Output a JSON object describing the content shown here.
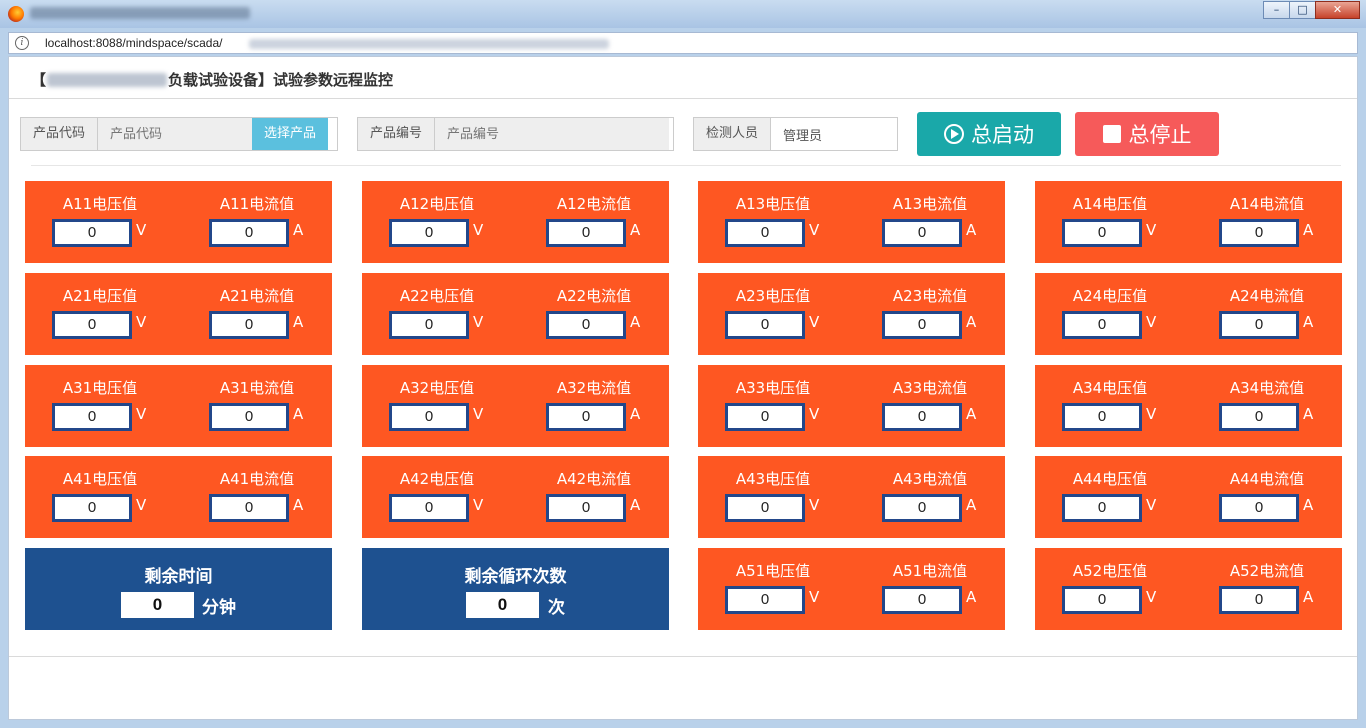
{
  "browser": {
    "url": "localhost:8088/mindspace/scada/",
    "window_controls": [
      "–",
      "□",
      "✕"
    ]
  },
  "page": {
    "title_prefix": "【",
    "title_suffix": "负载试验设备】试验参数远程监控"
  },
  "toolbar": {
    "product_code_label": "产品代码",
    "product_code_placeholder": "产品代码",
    "select_product": "选择产品",
    "product_no_label": "产品编号",
    "product_no_placeholder": "产品编号",
    "inspector_label": "检测人员",
    "inspector_value": "管理员",
    "start_label": "总启动",
    "stop_label": "总停止"
  },
  "units": {
    "voltage": "V",
    "current": "A"
  },
  "channels": [
    {
      "id": "A11",
      "voltage_label": "A11电压值",
      "current_label": "A11电流值",
      "voltage": "0",
      "current": "0"
    },
    {
      "id": "A12",
      "voltage_label": "A12电压值",
      "current_label": "A12电流值",
      "voltage": "0",
      "current": "0"
    },
    {
      "id": "A13",
      "voltage_label": "A13电压值",
      "current_label": "A13电流值",
      "voltage": "0",
      "current": "0"
    },
    {
      "id": "A14",
      "voltage_label": "A14电压值",
      "current_label": "A14电流值",
      "voltage": "0",
      "current": "0"
    },
    {
      "id": "A21",
      "voltage_label": "A21电压值",
      "current_label": "A21电流值",
      "voltage": "0",
      "current": "0"
    },
    {
      "id": "A22",
      "voltage_label": "A22电压值",
      "current_label": "A22电流值",
      "voltage": "0",
      "current": "0"
    },
    {
      "id": "A23",
      "voltage_label": "A23电压值",
      "current_label": "A23电流值",
      "voltage": "0",
      "current": "0"
    },
    {
      "id": "A24",
      "voltage_label": "A24电压值",
      "current_label": "A24电流值",
      "voltage": "0",
      "current": "0"
    },
    {
      "id": "A31",
      "voltage_label": "A31电压值",
      "current_label": "A31电流值",
      "voltage": "0",
      "current": "0"
    },
    {
      "id": "A32",
      "voltage_label": "A32电压值",
      "current_label": "A32电流值",
      "voltage": "0",
      "current": "0"
    },
    {
      "id": "A33",
      "voltage_label": "A33电压值",
      "current_label": "A33电流值",
      "voltage": "0",
      "current": "0"
    },
    {
      "id": "A34",
      "voltage_label": "A34电压值",
      "current_label": "A34电流值",
      "voltage": "0",
      "current": "0"
    },
    {
      "id": "A41",
      "voltage_label": "A41电压值",
      "current_label": "A41电流值",
      "voltage": "0",
      "current": "0"
    },
    {
      "id": "A42",
      "voltage_label": "A42电压值",
      "current_label": "A42电流值",
      "voltage": "0",
      "current": "0"
    },
    {
      "id": "A43",
      "voltage_label": "A43电压值",
      "current_label": "A43电流值",
      "voltage": "0",
      "current": "0"
    },
    {
      "id": "A44",
      "voltage_label": "A44电压值",
      "current_label": "A44电流值",
      "voltage": "0",
      "current": "0"
    },
    {
      "id": "A51",
      "voltage_label": "A51电压值",
      "current_label": "A51电流值",
      "voltage": "0",
      "current": "0"
    },
    {
      "id": "A52",
      "voltage_label": "A52电压值",
      "current_label": "A52电流值",
      "voltage": "0",
      "current": "0"
    }
  ],
  "remaining_time": {
    "label": "剩余时间",
    "value": "0",
    "unit": "分钟"
  },
  "remaining_cycles": {
    "label": "剩余循环次数",
    "value": "0",
    "unit": "次"
  },
  "colors": {
    "tile_orange": "#fe5722",
    "tile_blue": "#1e5190",
    "start_button": "#1aa8a9",
    "stop_button": "#f65a5a",
    "select_button": "#5bc0de"
  }
}
